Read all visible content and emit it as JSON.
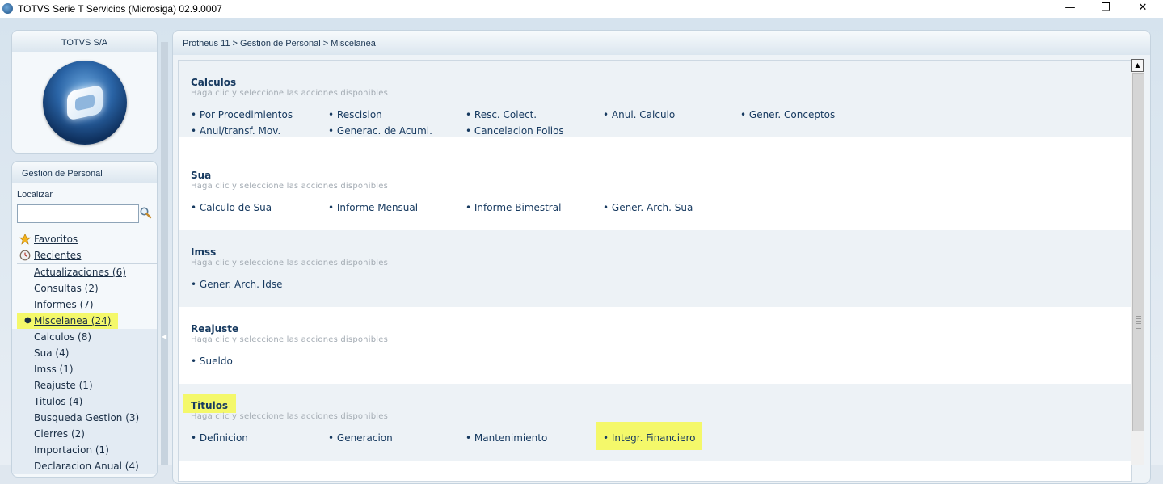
{
  "window": {
    "title": "TOTVS Serie T Servicios (Microsiga) 02.9.0007",
    "minimize": "—",
    "maximize": "❐",
    "close": "✕"
  },
  "company_panel": {
    "title": "TOTVS S/A"
  },
  "module_panel": {
    "title": "Gestion de Personal",
    "search_label": "Localizar",
    "search_value": "",
    "tree": [
      {
        "label": "Favoritos",
        "icon": "star-icon"
      },
      {
        "label": "Recientes",
        "icon": "clock-icon"
      },
      {
        "label": "Actualizaciones (6)"
      },
      {
        "label": "Consultas (2)"
      },
      {
        "label": "Informes (7)"
      },
      {
        "label": "Miscelanea (24)",
        "selected": true
      },
      {
        "label": "Calculos (8)"
      },
      {
        "label": "Sua (4)"
      },
      {
        "label": "Imss (1)"
      },
      {
        "label": "Reajuste (1)"
      },
      {
        "label": "Titulos (4)"
      },
      {
        "label": "Busqueda Gestion (3)"
      },
      {
        "label": "Cierres (2)"
      },
      {
        "label": "Importacion (1)"
      },
      {
        "label": "Declaracion Anual (4)"
      }
    ]
  },
  "breadcrumb": "Protheus 11 > Gestion de Personal > Miscelanea",
  "sections": [
    {
      "title": "Calculos",
      "subtitle": "Haga clic y seleccione las acciones disponibles",
      "actions": [
        "• Por Procedimientos",
        "• Rescision",
        "• Resc. Colect.",
        "• Anul. Calculo",
        "• Gener. Conceptos",
        "• Anul/transf. Mov.",
        "• Generac. de Acuml.",
        "• Cancelacion Folios"
      ]
    },
    {
      "title": "Sua",
      "subtitle": "Haga clic y seleccione las acciones disponibles",
      "actions": [
        "• Calculo de Sua",
        "• Informe Mensual",
        "• Informe Bimestral",
        "• Gener. Arch. Sua"
      ]
    },
    {
      "title": "Imss",
      "subtitle": "Haga clic y seleccione las acciones disponibles",
      "actions": [
        "• Gener. Arch. Idse"
      ]
    },
    {
      "title": "Reajuste",
      "subtitle": "Haga clic y seleccione las acciones disponibles",
      "actions": [
        "• Sueldo"
      ]
    },
    {
      "title": "Titulos",
      "subtitle": "Haga clic y seleccione las acciones disponibles",
      "actions": [
        "• Definicion",
        "• Generacion",
        "• Mantenimiento",
        "• Integr. Financiero"
      ]
    }
  ],
  "colors": {
    "highlight": "#f4f86a",
    "link": "#173a60"
  }
}
